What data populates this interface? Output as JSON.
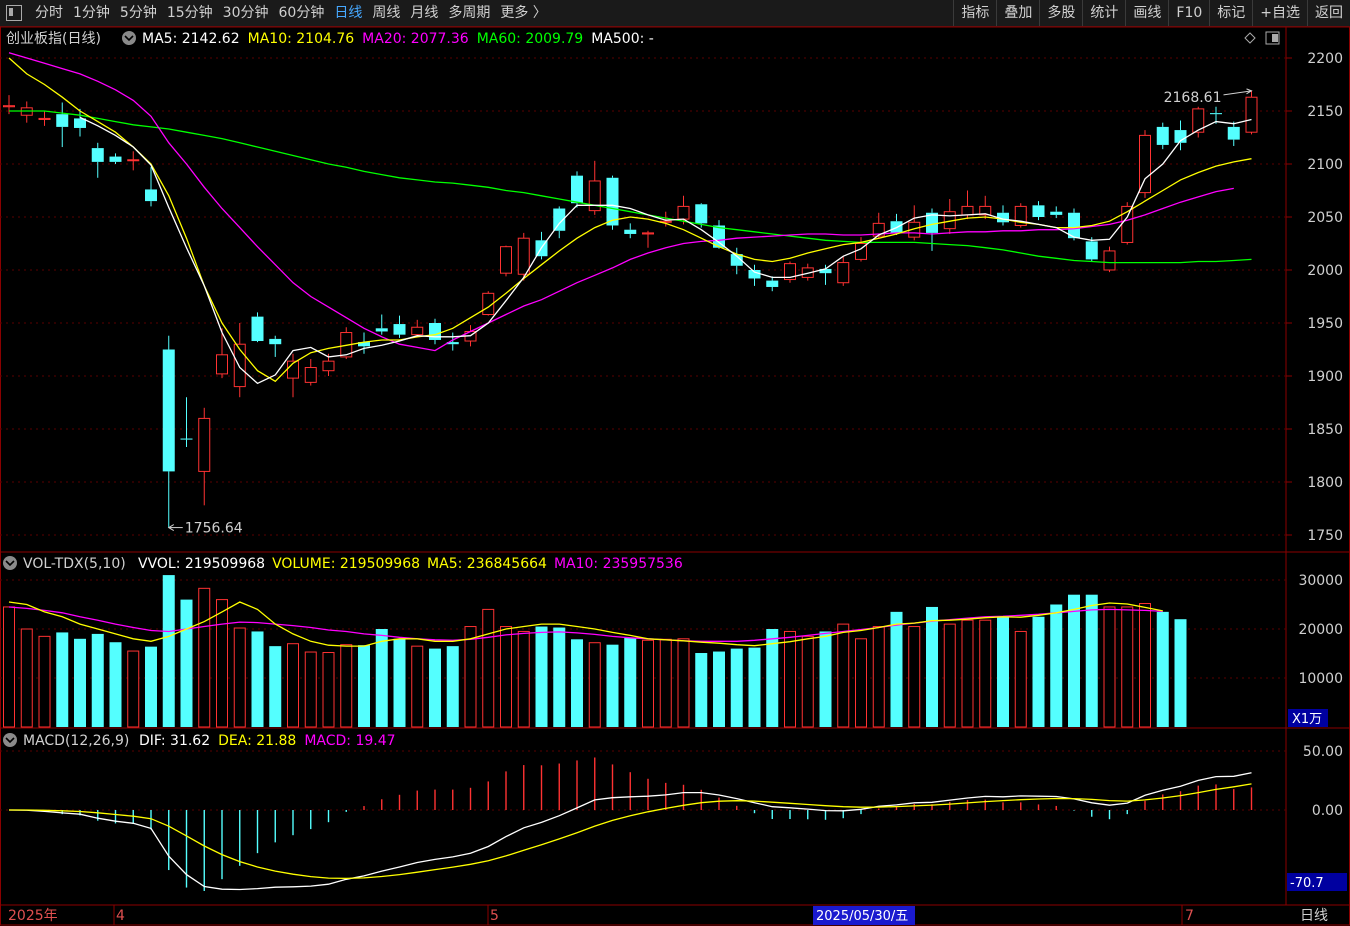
{
  "toolbar": {
    "periods": [
      "分时",
      "1分钟",
      "5分钟",
      "15分钟",
      "30分钟",
      "60分钟",
      "日线",
      "周线",
      "月线",
      "多周期",
      "更多 〉"
    ],
    "active_period": "日线",
    "tools": [
      "指标",
      "叠加",
      "多股",
      "统计",
      "画线",
      "F10",
      "标记",
      "+自选",
      "返回"
    ]
  },
  "main_panel": {
    "name": "创业板指(日线)",
    "ma": [
      {
        "label": "MA5: 2142.62",
        "color": "#ffffff"
      },
      {
        "label": "MA10: 2104.76",
        "color": "#ffff00"
      },
      {
        "label": "MA20: 2077.36",
        "color": "#ff00ff"
      },
      {
        "label": "MA60: 2009.79",
        "color": "#00ff00"
      },
      {
        "label": "MA500: -",
        "color": "#ffffff"
      }
    ],
    "y_ticks": [
      "2200",
      "2150",
      "2100",
      "2050",
      "2000",
      "1950",
      "1900",
      "1850",
      "1800",
      "1750"
    ],
    "high_label": "2168.61",
    "low_label": "1756.64"
  },
  "vol_panel": {
    "name": "VOL-TDX(5,10)",
    "items": [
      {
        "label": "VVOL: 219509968",
        "color": "#ffffff"
      },
      {
        "label": "VOLUME: 219509968",
        "color": "#ffff00"
      },
      {
        "label": "MA5: 236845664",
        "color": "#ffff00"
      },
      {
        "label": "MA10: 235957536",
        "color": "#ff00ff"
      }
    ],
    "y_ticks": [
      "30000",
      "20000",
      "10000"
    ],
    "unit": "X1万"
  },
  "macd_panel": {
    "name": "MACD(12,26,9)",
    "items": [
      {
        "label": "DIF: 31.62",
        "color": "#ffffff"
      },
      {
        "label": "DEA: 21.88",
        "color": "#ffff00"
      },
      {
        "label": "MACD: 19.47",
        "color": "#ff00ff"
      }
    ],
    "y_ticks": [
      "50.00",
      "0.00"
    ],
    "cursor_value": "-70.7"
  },
  "x_axis": {
    "labels": [
      "2025年",
      "4",
      "5",
      "7"
    ],
    "cursor_date": "2025/05/30/五",
    "period_label": "日线"
  },
  "chart_data": {
    "type": "candlestick",
    "title": "创业板指(日线)",
    "ylim": [
      1740,
      2210
    ],
    "candles": [
      [
        2154,
        2155,
        2165,
        2147
      ],
      [
        2146,
        2153,
        2159,
        2139
      ],
      [
        2142,
        2143,
        2150,
        2136
      ],
      [
        2147,
        2135,
        2158,
        2116
      ],
      [
        2143,
        2134,
        2152,
        2126
      ],
      [
        2115,
        2102,
        2120,
        2087
      ],
      [
        2107,
        2102,
        2110,
        2100
      ],
      [
        2104,
        2104,
        2112,
        2094
      ],
      [
        2076,
        2065,
        2097,
        2060
      ],
      [
        1925,
        1810,
        1938,
        1757
      ],
      [
        1841,
        1840,
        1880,
        1833
      ],
      [
        1810,
        1860,
        1870,
        1778
      ],
      [
        1902,
        1920,
        1945,
        1898
      ],
      [
        1890,
        1930,
        1950,
        1880
      ],
      [
        1956,
        1933,
        1960,
        1932
      ],
      [
        1935,
        1930,
        1938,
        1918
      ],
      [
        1898,
        1914,
        1921,
        1880
      ],
      [
        1894,
        1908,
        1916,
        1891
      ],
      [
        1905,
        1914,
        1921,
        1900
      ],
      [
        1918,
        1941,
        1946,
        1916
      ],
      [
        1932,
        1928,
        1941,
        1921
      ],
      [
        1945,
        1942,
        1958,
        1939
      ],
      [
        1949,
        1939,
        1957,
        1936
      ],
      [
        1939,
        1946,
        1953,
        1938
      ],
      [
        1950,
        1934,
        1954,
        1930
      ],
      [
        1932,
        1930,
        1941,
        1924
      ],
      [
        1933,
        1942,
        1948,
        1928
      ],
      [
        1958,
        1978,
        1980,
        1957
      ],
      [
        1997,
        2022,
        2023,
        1994
      ],
      [
        1996,
        2030,
        2035,
        1990
      ],
      [
        2028,
        2013,
        2036,
        2010
      ],
      [
        2058,
        2037,
        2060,
        2030
      ],
      [
        2089,
        2063,
        2093,
        2059
      ],
      [
        2056,
        2084,
        2103,
        2052
      ],
      [
        2087,
        2042,
        2089,
        2038
      ],
      [
        2038,
        2034,
        2044,
        2030
      ],
      [
        2034,
        2035,
        2037,
        2021
      ],
      [
        2045,
        2046,
        2055,
        2041
      ],
      [
        2048,
        2060,
        2070,
        2043
      ],
      [
        2062,
        2044,
        2063,
        2040
      ],
      [
        2042,
        2021,
        2047,
        2020
      ],
      [
        2015,
        2004,
        2021,
        1996
      ],
      [
        2000,
        1992,
        2005,
        1985
      ],
      [
        1990,
        1984,
        1994,
        1980
      ],
      [
        1991,
        2006,
        2008,
        1988
      ],
      [
        1993,
        2002,
        2006,
        1990
      ],
      [
        2001,
        1997,
        2005,
        1986
      ],
      [
        1988,
        2007,
        2013,
        1985
      ],
      [
        2010,
        2025,
        2031,
        2008
      ],
      [
        2032,
        2044,
        2054,
        2030
      ],
      [
        2046,
        2035,
        2053,
        2033
      ],
      [
        2031,
        2045,
        2061,
        2028
      ],
      [
        2054,
        2035,
        2058,
        2018
      ],
      [
        2039,
        2055,
        2067,
        2034
      ],
      [
        2052,
        2060,
        2075,
        2048
      ],
      [
        2052,
        2060,
        2070,
        2048
      ],
      [
        2054,
        2045,
        2061,
        2042
      ],
      [
        2042,
        2060,
        2063,
        2040
      ],
      [
        2061,
        2050,
        2065,
        2047
      ],
      [
        2055,
        2052,
        2060,
        2049
      ],
      [
        2054,
        2030,
        2058,
        2028
      ],
      [
        2027,
        2010,
        2031,
        2008
      ],
      [
        2000,
        2018,
        2022,
        1998
      ],
      [
        2026,
        2060,
        2064,
        2024
      ],
      [
        2073,
        2127,
        2132,
        2068
      ],
      [
        2135,
        2118,
        2139,
        2114
      ],
      [
        2132,
        2120,
        2141,
        2113
      ],
      [
        2130,
        2152,
        2154,
        2125
      ],
      [
        2148,
        2147,
        2154,
        2138
      ],
      [
        2135,
        2123,
        2140,
        2117
      ],
      [
        2130,
        2163,
        2169,
        2128
      ]
    ],
    "ma5": [
      null,
      null,
      null,
      null,
      2144,
      2136,
      2127,
      2116,
      2099,
      2059,
      2021,
      1985,
      1941,
      1908,
      1893,
      1901,
      1924,
      1927,
      1918,
      1920,
      1926,
      1929,
      1933,
      1938,
      1937,
      1937,
      1938,
      1950,
      1971,
      1993,
      2021,
      2044,
      2061,
      2061,
      2061,
      2058,
      2052,
      2047,
      2048,
      2038,
      2026,
      2013,
      1998,
      1993,
      1993,
      1997,
      2001,
      2013,
      2020,
      2033,
      2040,
      2049,
      2052,
      2051,
      2052,
      2053,
      2048,
      2046,
      2043,
      2040,
      2031,
      2028,
      2029,
      2050,
      2086,
      2100,
      2122,
      2132,
      2140,
      2138,
      2142
    ],
    "ma10": [
      2200,
      2185,
      2175,
      2163,
      2150,
      2140,
      2130,
      2116,
      2100,
      2070,
      2030,
      1985,
      1950,
      1925,
      1905,
      1895,
      1912,
      1922,
      1926,
      1929,
      1932,
      1934,
      1934,
      1937,
      1939,
      1945,
      1955,
      1965,
      1978,
      1992,
      2005,
      2018,
      2030,
      2040,
      2047,
      2050,
      2048,
      2044,
      2038,
      2030,
      2022,
      2015,
      2010,
      2008,
      2011,
      2016,
      2020,
      2024,
      2026,
      2030,
      2034,
      2039,
      2043,
      2046,
      2049,
      2050,
      2048,
      2045,
      2043,
      2040,
      2040,
      2042,
      2046,
      2055,
      2065,
      2075,
      2085,
      2092,
      2098,
      2102,
      2105
    ],
    "ma20": [
      2205,
      2200,
      2195,
      2190,
      2185,
      2178,
      2170,
      2160,
      2145,
      2120,
      2100,
      2078,
      2058,
      2040,
      2022,
      2005,
      1988,
      1975,
      1965,
      1955,
      1945,
      1937,
      1930,
      1927,
      1924,
      1934,
      1942,
      1950,
      1958,
      1966,
      1972,
      1980,
      1988,
      1995,
      2002,
      2010,
      2016,
      2021,
      2025,
      2027,
      2028,
      2030,
      2031,
      2032,
      2033,
      2034,
      2034,
      2033,
      2033,
      2034,
      2035,
      2035,
      2034,
      2035,
      2036,
      2036,
      2037,
      2037,
      2038,
      2038,
      2039,
      2041,
      2043,
      2047,
      2052,
      2058,
      2064,
      2069,
      2074,
      2077
    ],
    "ma60": [
      2150,
      2150,
      2150,
      2148,
      2146,
      2143,
      2140,
      2137,
      2135,
      2133,
      2130,
      2127,
      2124,
      2120,
      2116,
      2112,
      2108,
      2104,
      2100,
      2097,
      2093,
      2090,
      2087,
      2085,
      2083,
      2082,
      2080,
      2078,
      2075,
      2073,
      2070,
      2067,
      2064,
      2061,
      2058,
      2055,
      2052,
      2049,
      2046,
      2043,
      2040,
      2038,
      2036,
      2034,
      2032,
      2030,
      2028,
      2027,
      2026,
      2026,
      2026,
      2026,
      2025,
      2024,
      2023,
      2021,
      2019,
      2016,
      2013,
      2011,
      2009,
      2008,
      2007,
      2007,
      2007,
      2007,
      2007,
      2008,
      2008,
      2009,
      2010
    ],
    "volume": [
      24500,
      20000,
      18500,
      19300,
      18000,
      19000,
      17300,
      15500,
      16400,
      31000,
      26000,
      28300,
      26000,
      20200,
      19500,
      16500,
      17000,
      15300,
      15200,
      16800,
      16700,
      20000,
      18000,
      16500,
      16000,
      16500,
      20500,
      24000,
      20500,
      19500,
      20500,
      20300,
      17900,
      17200,
      16800,
      18200,
      17700,
      17900,
      18000,
      15100,
      15400,
      16000,
      16200,
      20000,
      19500,
      18500,
      19500,
      21000,
      18000,
      20500,
      23500,
      20500,
      24500,
      21000,
      21800,
      21800,
      22500,
      19500,
      22500,
      25000,
      27000,
      27000,
      24500,
      24500,
      25200,
      23500,
      22000
    ],
    "vol_ma5": [
      25500,
      25000,
      23500,
      22500,
      21000,
      20000,
      19000,
      18000,
      17500,
      18500,
      20000,
      21500,
      23500,
      25500,
      24000,
      21000,
      19000,
      17500,
      16700,
      16500,
      16500,
      17500,
      18000,
      18000,
      17500,
      17500,
      18000,
      19000,
      20000,
      20500,
      21000,
      21000,
      20500,
      20000,
      19300,
      18700,
      18000,
      17800,
      17600,
      17300,
      17100,
      16800,
      16600,
      17000,
      17400,
      18000,
      18500,
      19300,
      19700,
      20300,
      21000,
      21200,
      21700,
      21800,
      22000,
      22300,
      22500,
      22400,
      22800,
      23300,
      24000,
      24800,
      25300,
      25100,
      24400,
      23700
    ],
    "vol_ma10": [
      24500,
      24200,
      23800,
      23300,
      22500,
      21800,
      21000,
      20300,
      19700,
      19500,
      20000,
      20500,
      21000,
      21400,
      21300,
      21000,
      20700,
      20300,
      19800,
      19500,
      19000,
      18700,
      18300,
      18000,
      17800,
      17700,
      17900,
      18300,
      18800,
      19100,
      19300,
      19400,
      19200,
      18900,
      18500,
      18200,
      18000,
      17800,
      17600,
      17500,
      17500,
      17500,
      17700,
      18000,
      18300,
      18700,
      19100,
      19500,
      19900,
      20300,
      20800,
      21200,
      21600,
      21900,
      22200,
      22500,
      22600,
      22800,
      23000,
      23300,
      23600,
      23900,
      24000,
      23900,
      23800,
      23600
    ]
  }
}
